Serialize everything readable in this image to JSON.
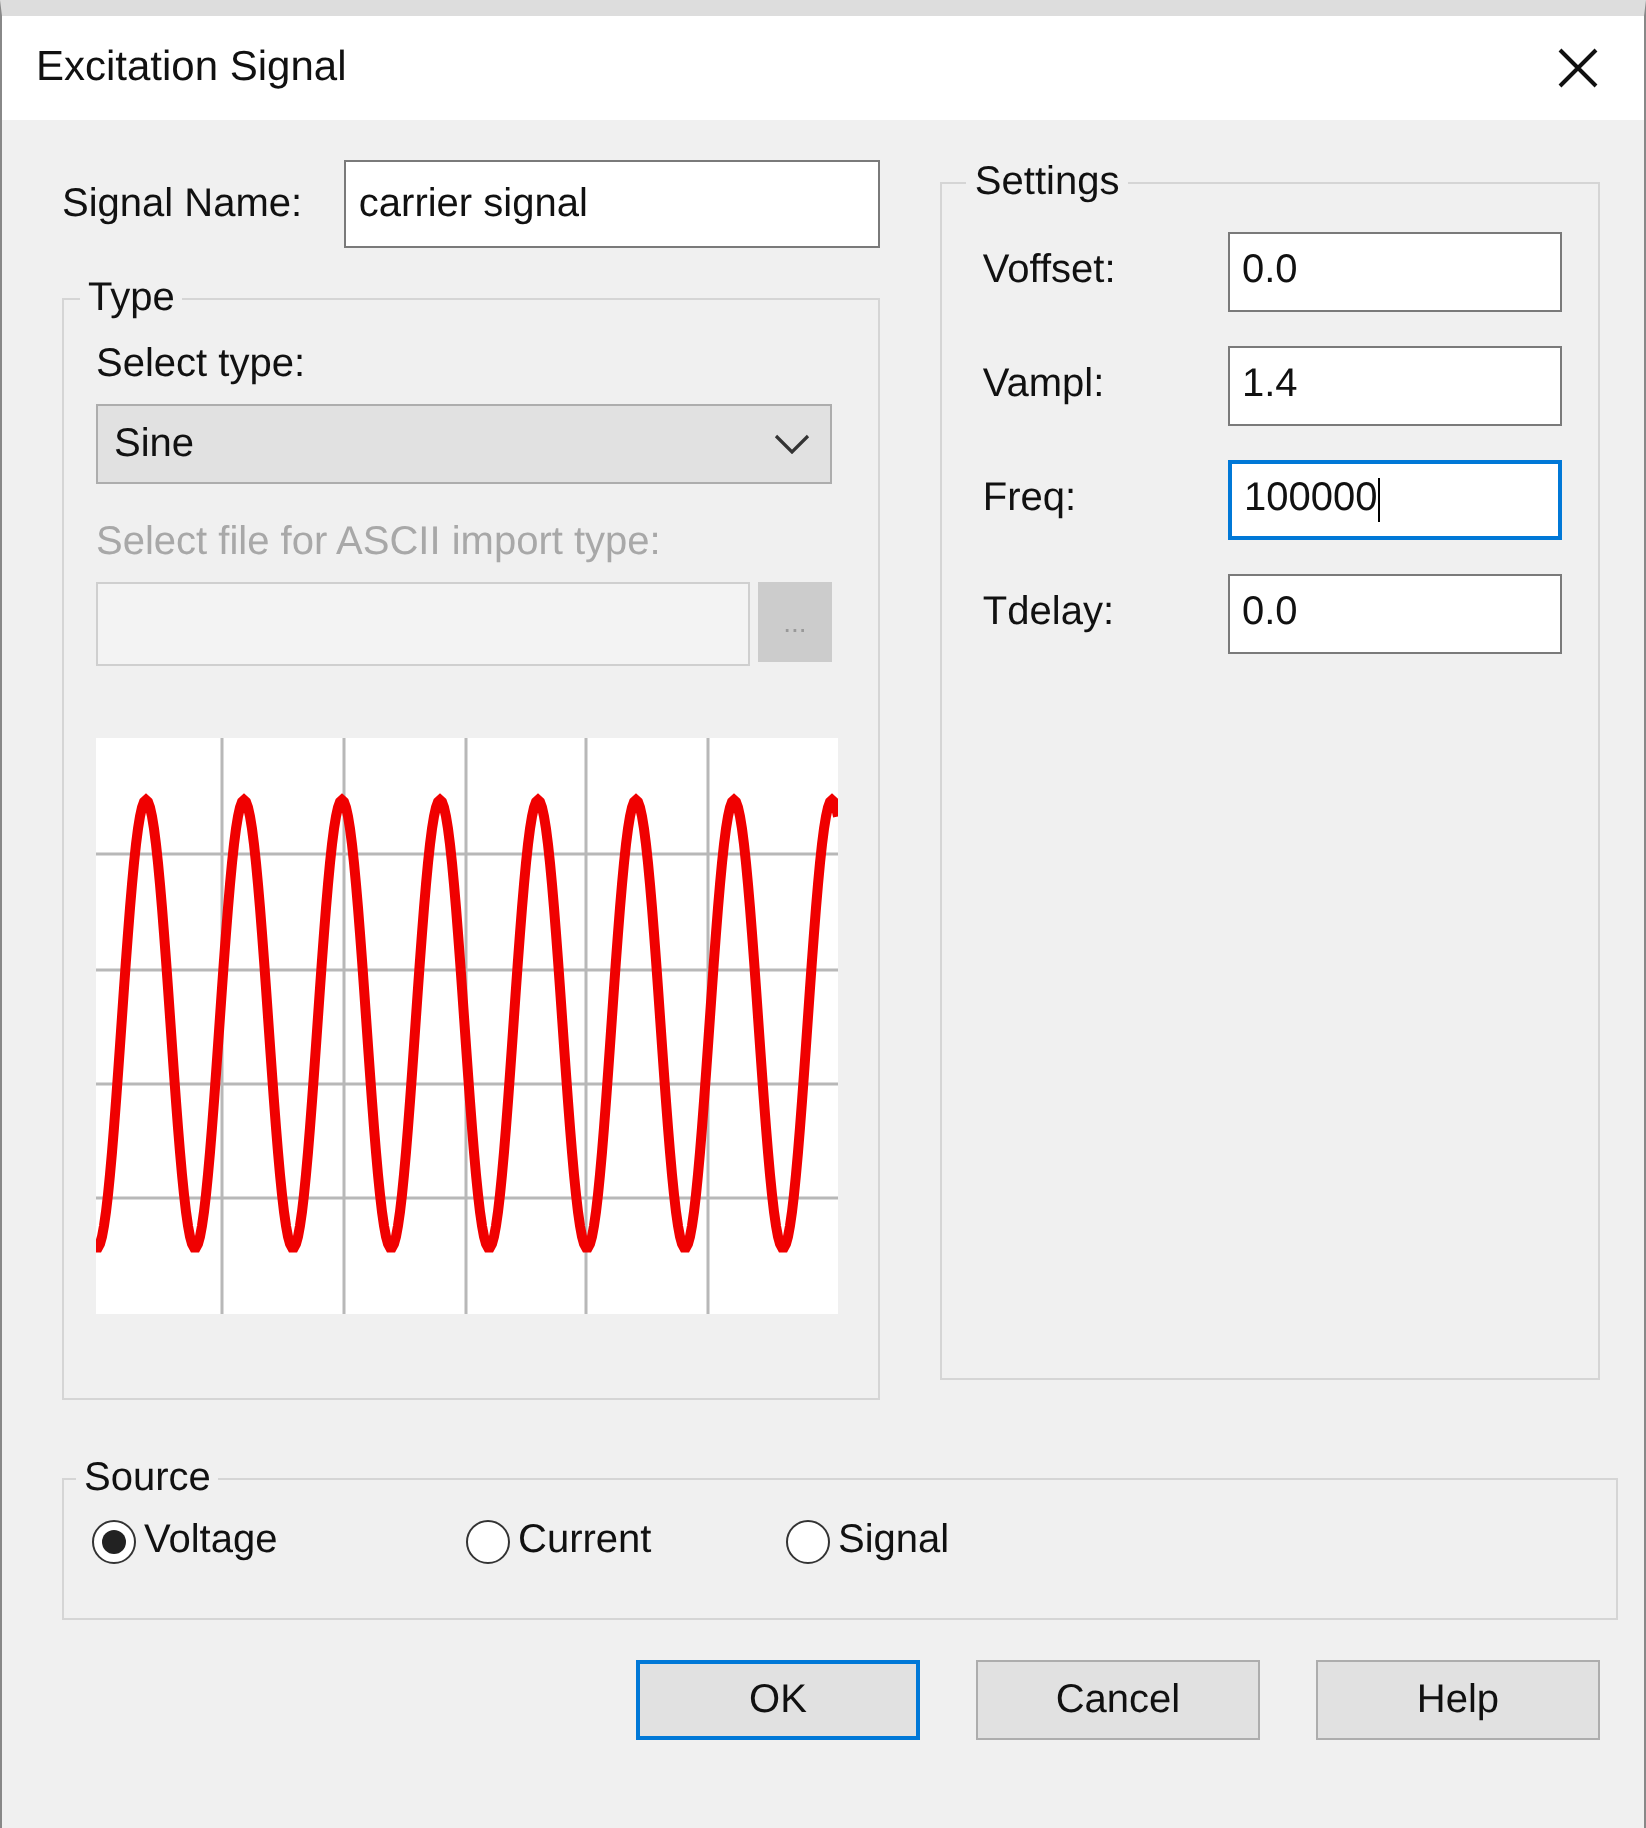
{
  "window": {
    "title": "Excitation Signal"
  },
  "signal_name": {
    "label": "Signal Name:",
    "value": "carrier signal"
  },
  "type": {
    "title": "Type",
    "select_label": "Select type:",
    "select_value": "Sine",
    "file_label": "Select file for ASCII import type:",
    "file_disabled": true,
    "browse_button": "..."
  },
  "settings": {
    "title": "Settings",
    "fields": [
      {
        "label": "Voffset:",
        "value": "0.0",
        "focused": false
      },
      {
        "label": "Vampl:",
        "value": "1.4",
        "focused": false
      },
      {
        "label": "Freq:",
        "value": "100000",
        "focused": true
      },
      {
        "label": "Tdelay:",
        "value": "0.0",
        "focused": false
      }
    ]
  },
  "source": {
    "title": "Source",
    "options": [
      {
        "label": "Voltage",
        "selected": true
      },
      {
        "label": "Current",
        "selected": false
      },
      {
        "label": "Signal",
        "selected": false
      }
    ]
  },
  "buttons": [
    {
      "label": "OK",
      "default": true
    },
    {
      "label": "Cancel",
      "default": false
    },
    {
      "label": "Help",
      "default": false
    }
  ]
}
